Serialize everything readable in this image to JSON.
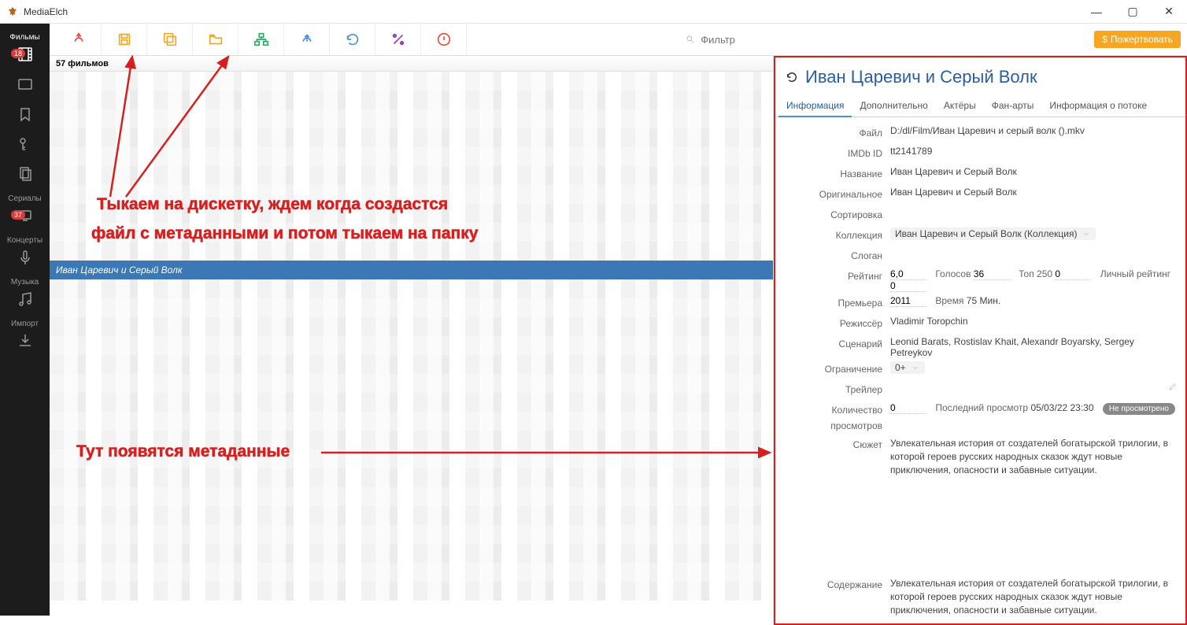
{
  "titlebar": {
    "app": "MediaElch"
  },
  "nav": {
    "movies": {
      "label": "Фильмы",
      "badge": "18"
    },
    "tvshows": {
      "label": "Сериалы",
      "badge": "37"
    },
    "concerts": {
      "label": "Концерты"
    },
    "music": {
      "label": "Музыка"
    },
    "import": {
      "label": "Импорт"
    }
  },
  "toolbar": {
    "filter_placeholder": "Фильтр",
    "donate": "Пожертвовать"
  },
  "list": {
    "header": "57 фильмов",
    "selected": "Иван Царевич и Серый Волк"
  },
  "detail": {
    "title": "Иван Царевич и Серый Волк",
    "tabs": {
      "info": "Информация",
      "extra": "Дополнительно",
      "actors": "Актёры",
      "fanart": "Фан-арты",
      "stream": "Информация о потоке"
    },
    "labels": {
      "file": "Файл",
      "imdb": "IMDb ID",
      "name": "Название",
      "original": "Оригинальное",
      "sort": "Сортировка",
      "collection": "Коллекция",
      "slogan": "Слоган",
      "rating": "Рейтинг",
      "votes_l": "Голосов",
      "top250_l": "Топ 250",
      "personal_l": "Личный рейтинг",
      "premiere": "Премьера",
      "runtime_l": "Время",
      "minutes": "Мин.",
      "director": "Режиссёр",
      "scenario": "Сценарий",
      "cert": "Ограничение",
      "trailer": "Трейлер",
      "playcount": "Количество просмотров",
      "lastplayed_l": "Последний просмотр",
      "unseen": "Не просмотрено",
      "plot": "Сюжет",
      "content": "Содержание"
    },
    "values": {
      "file": "D:/dl/Film/Иван Царевич и серый волк ().mkv",
      "imdb": "tt2141789",
      "name": "Иван Царевич и Серый Волк",
      "original": "Иван Царевич и Серый Волк",
      "sort": "",
      "collection": "Иван Царевич и Серый Волк (Коллекция)",
      "slogan": "",
      "rating": "6,0",
      "votes": "36",
      "top250": "0",
      "personal": "0",
      "premiere": "2011",
      "runtime": "75",
      "director": "Vladimir Toropchin",
      "scenario": "Leonid Barats, Rostislav Khait, Alexandr Boyarsky, Sergey Petreykov",
      "cert": "0+",
      "trailer": "",
      "playcount": "0",
      "lastplayed": "05/03/22 23:30",
      "plot": "Увлекательная история от создателей богатырской трилогии, в которой героев русских народных сказок ждут новые приключения, опасности и забавные ситуации.",
      "content": "Увлекательная история от создателей богатырской трилогии, в которой героев русских народных сказок ждут новые приключения, опасности и забавные ситуации."
    }
  },
  "anno": {
    "line1": "Тыкаем на дискетку, ждем когда создастся",
    "line2": "файл с метаданными и потом тыкаем на папку",
    "line3": "Тут появятся метаданные"
  }
}
